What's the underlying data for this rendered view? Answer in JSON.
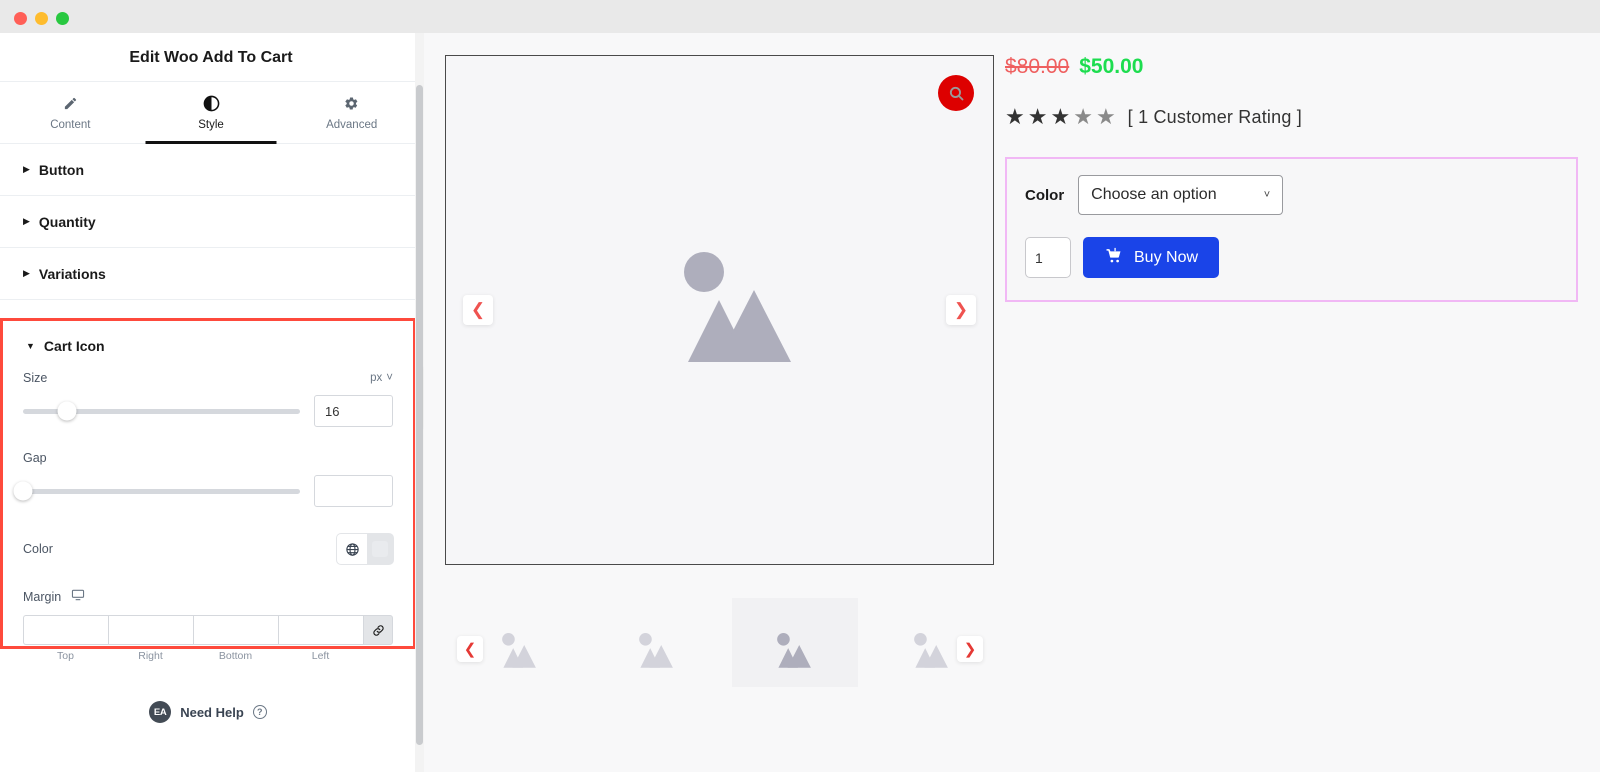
{
  "window": {
    "traffic_lights": [
      "close",
      "minimize",
      "maximize"
    ]
  },
  "editor": {
    "title": "Edit Woo Add To Cart",
    "tabs": [
      {
        "label": "Content",
        "icon": "pencil-icon",
        "active": false
      },
      {
        "label": "Style",
        "icon": "contrast-icon",
        "active": true
      },
      {
        "label": "Advanced",
        "icon": "gear-icon",
        "active": false
      }
    ],
    "sections": [
      {
        "label": "Button",
        "expanded": false
      },
      {
        "label": "Quantity",
        "expanded": false
      },
      {
        "label": "Variations",
        "expanded": false
      }
    ],
    "cart_icon": {
      "title": "Cart Icon",
      "expanded": true,
      "highlight_color": "#fe4a3c",
      "size": {
        "label": "Size",
        "unit": "px",
        "value": "16",
        "slider_percent": 16
      },
      "gap": {
        "label": "Gap",
        "value": "",
        "slider_percent": 0
      },
      "color": {
        "label": "Color",
        "globe_icon": "globe-icon",
        "swatch_value": ""
      },
      "margin": {
        "label": "Margin",
        "device_icon": "desktop-icon",
        "link_icon": "link-icon",
        "fields": [
          {
            "label": "Top",
            "value": ""
          },
          {
            "label": "Right",
            "value": ""
          },
          {
            "label": "Bottom",
            "value": ""
          },
          {
            "label": "Left",
            "value": ""
          }
        ]
      }
    },
    "footer": {
      "badge": "EA",
      "text": "Need Help",
      "help_icon": "question-mark-icon"
    },
    "collapse_handle_icon": "chevron-left-icon"
  },
  "preview": {
    "gallery": {
      "zoom_icon": "search-icon",
      "zoom_badge_color": "#dd0000",
      "prev_arrow": "chevron-left-icon",
      "next_arrow": "chevron-right-icon",
      "placeholder_icon": "image-placeholder-icon",
      "thumbnails": [
        {
          "icon": "image-placeholder-icon",
          "selected": false
        },
        {
          "icon": "image-placeholder-icon",
          "selected": false
        },
        {
          "icon": "image-placeholder-icon",
          "selected": true
        },
        {
          "icon": "image-placeholder-icon",
          "selected": false
        }
      ],
      "thumb_prev_arrow": "chevron-left-icon",
      "thumb_next_arrow": "chevron-right-icon"
    },
    "product": {
      "price_old": "$80.00",
      "price_new": "$50.00",
      "price_old_color": "#ef5f5f",
      "price_new_color": "#1ddd4f",
      "rating_filled": 3,
      "rating_total": 5,
      "rating_text": "[ 1 Customer Rating ]",
      "variation": {
        "border_color": "#f1b8f5",
        "attribute_label": "Color",
        "select_value": "Choose an option",
        "select_chevron": "chevron-down-icon"
      },
      "quantity_value": "1",
      "buy_button": {
        "label": "Buy Now",
        "icon": "cart-icon",
        "color": "#1a44e8"
      }
    }
  }
}
